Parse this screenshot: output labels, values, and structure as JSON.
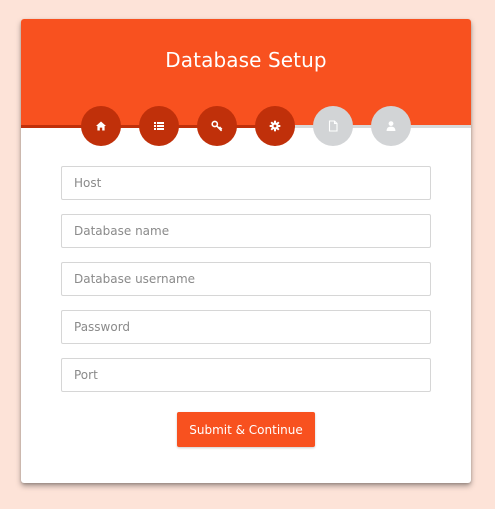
{
  "header": {
    "title": "Database Setup"
  },
  "steps": [
    {
      "icon": "home-icon",
      "status": "complete"
    },
    {
      "icon": "list-icon",
      "status": "complete"
    },
    {
      "icon": "key-icon",
      "status": "complete"
    },
    {
      "icon": "gear-icon",
      "status": "complete"
    },
    {
      "icon": "file-icon",
      "status": "incomplete"
    },
    {
      "icon": "user-icon",
      "status": "incomplete"
    }
  ],
  "form": {
    "host_placeholder": "Host",
    "dbname_placeholder": "Database name",
    "username_placeholder": "Database username",
    "password_placeholder": "Password",
    "port_placeholder": "Port",
    "submit_label": "Submit & Continue"
  },
  "colors": {
    "page_background": "#fde3d8",
    "accent": "#f8511f",
    "step_complete": "#c0300a",
    "step_incomplete": "#d2d4d6"
  }
}
